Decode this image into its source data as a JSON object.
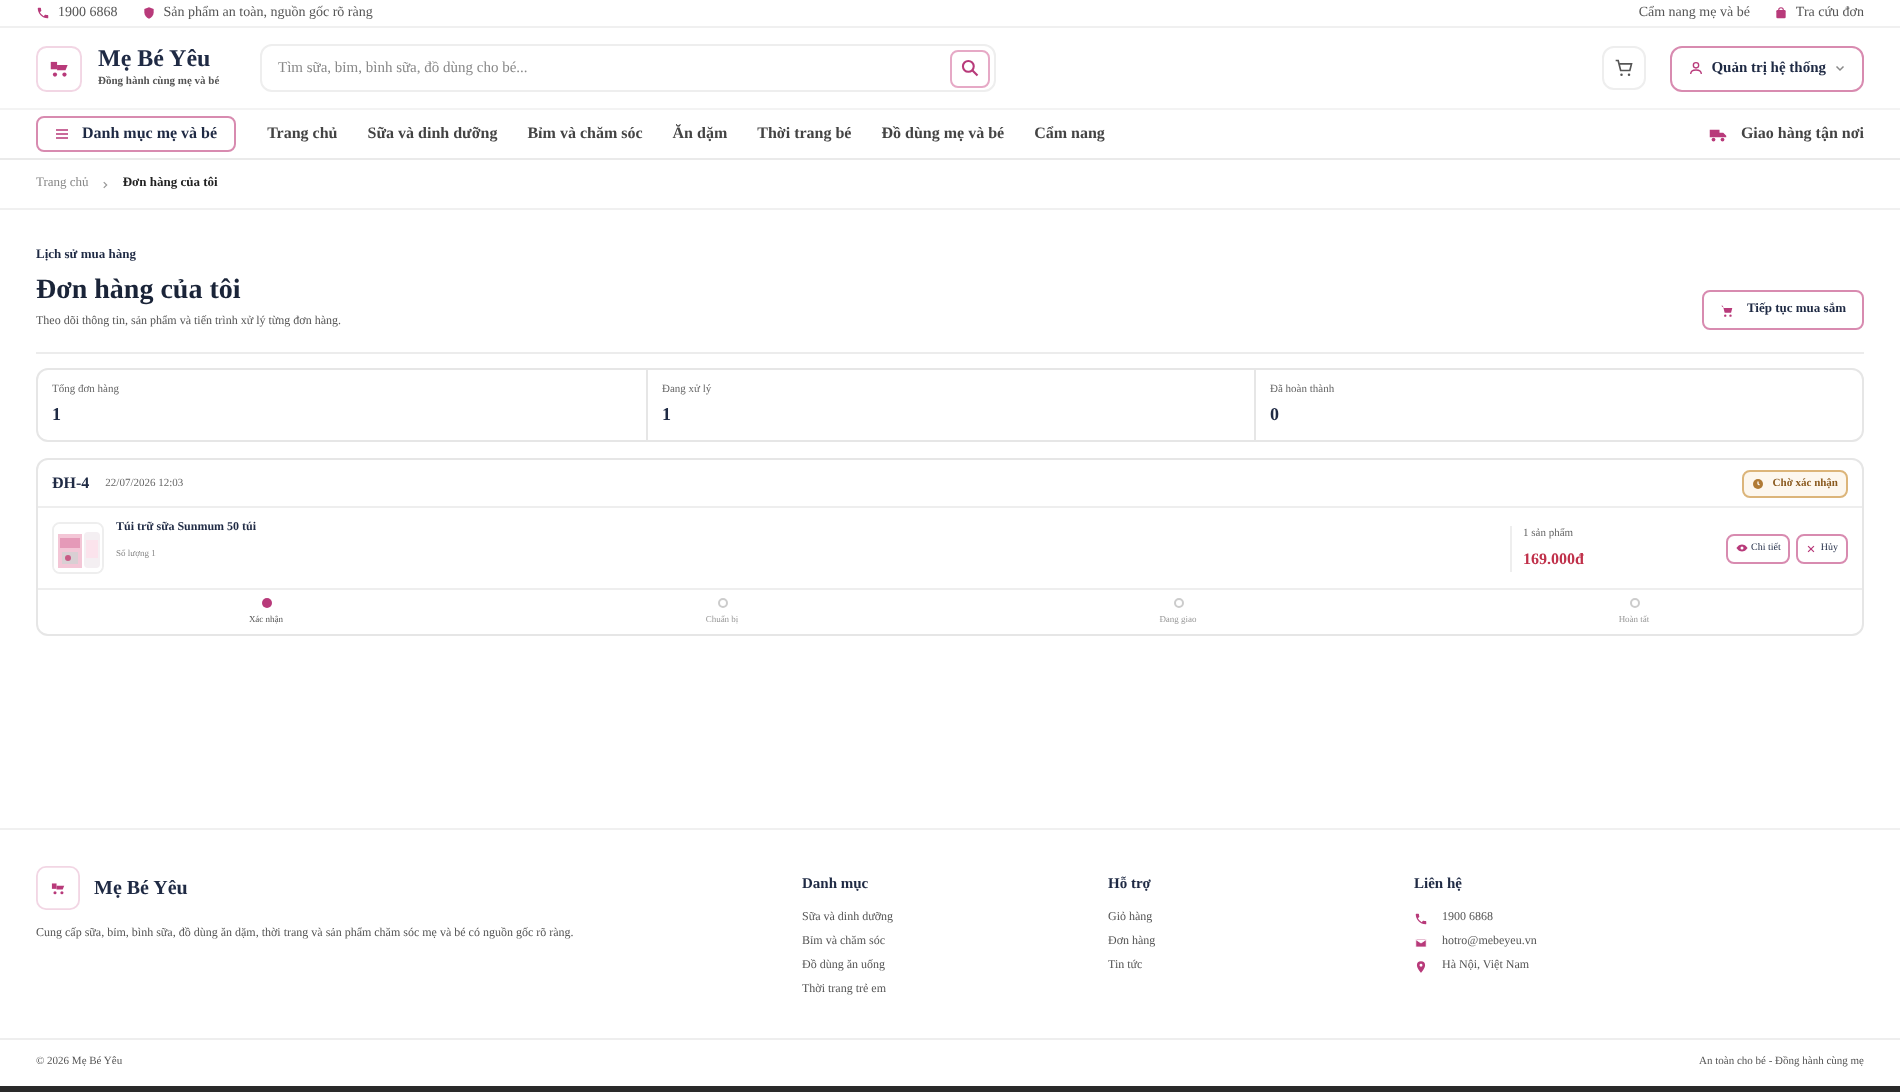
{
  "top_bar": {
    "phone": "1900 6868",
    "promise": "Sản phẩm an toàn, nguồn gốc rõ ràng",
    "links": [
      "Cẩm nang mẹ và bé",
      "Tra cứu đơn"
    ]
  },
  "header": {
    "brand": "Mẹ Bé Yêu",
    "tagline": "Đồng hành cùng mẹ và bé",
    "search": {
      "placeholder": "Tìm sữa, bỉm, bình sữa, đồ dùng cho bé..."
    },
    "account_button": "Quản trị hệ thống"
  },
  "nav": {
    "category_button": "Danh mục mẹ và bé",
    "items": [
      "Trang chủ",
      "Sữa và dinh dưỡng",
      "Bỉm và chăm sóc",
      "Ăn dặm",
      "Thời trang bé",
      "Đồ dùng mẹ và bé",
      "Cẩm nang"
    ],
    "delivery": "Giao hàng tận nơi"
  },
  "breadcrumb": [
    "Trang chủ",
    "Đơn hàng của tôi"
  ],
  "page": {
    "eyebrow": "Lịch sử mua hàng",
    "title": "Đơn hàng của tôi",
    "subtitle": "Theo dõi thông tin, sản phẩm và tiến trình xử lý từng đơn hàng.",
    "continue_button": "Tiếp tục mua sắm"
  },
  "stats": [
    {
      "label": "Tổng đơn hàng",
      "value": "1"
    },
    {
      "label": "Đang xử lý",
      "value": "1"
    },
    {
      "label": "Đã hoàn thành",
      "value": "0"
    }
  ],
  "orders": [
    {
      "code": "ĐH-4",
      "date": "22/07/2026 12:03",
      "status": "Chờ xác nhận",
      "product": {
        "name": "Túi trữ sữa Sunmum 50 túi",
        "quantity": "Số lượng 1",
        "kind": "picture"
      },
      "item_count": "1 sản phẩm",
      "total": "169.000đ",
      "buttons": [
        "Chi tiết",
        "Hủy"
      ],
      "steps": [
        {
          "label": "Xác nhận",
          "done": true
        },
        {
          "label": "Chuẩn bị",
          "done": false
        },
        {
          "label": "Đang giao",
          "done": false
        },
        {
          "label": "Hoàn tất",
          "done": false
        }
      ]
    }
  ],
  "footer": {
    "brand": "Mẹ Bé Yêu",
    "description": "Cung cấp sữa, bỉm, bình sữa, đồ dùng ăn dặm, thời trang và sản phẩm chăm sóc mẹ và bé có nguồn gốc rõ ràng.",
    "columns": [
      {
        "title": "Danh mục",
        "links": [
          "Sữa và dinh dưỡng",
          "Bỉm và chăm sóc",
          "Đồ dùng ăn uống",
          "Thời trang trẻ em"
        ]
      },
      {
        "title": "Hỗ trợ",
        "links": [
          "Giỏ hàng",
          "Đơn hàng",
          "Tin tức"
        ]
      }
    ],
    "contact": {
      "title": "Liên hệ",
      "items": [
        {
          "kind": "phone",
          "text": "1900 6868"
        },
        {
          "kind": "email",
          "text": "hotro@mebeyeu.vn"
        },
        {
          "kind": "location",
          "text": "Hà Nội, Việt Nam"
        }
      ]
    },
    "copyright": "© 2026 Mẹ Bé Yêu",
    "slogan": "An toàn cho bé - Đồng hành cùng mẹ"
  }
}
